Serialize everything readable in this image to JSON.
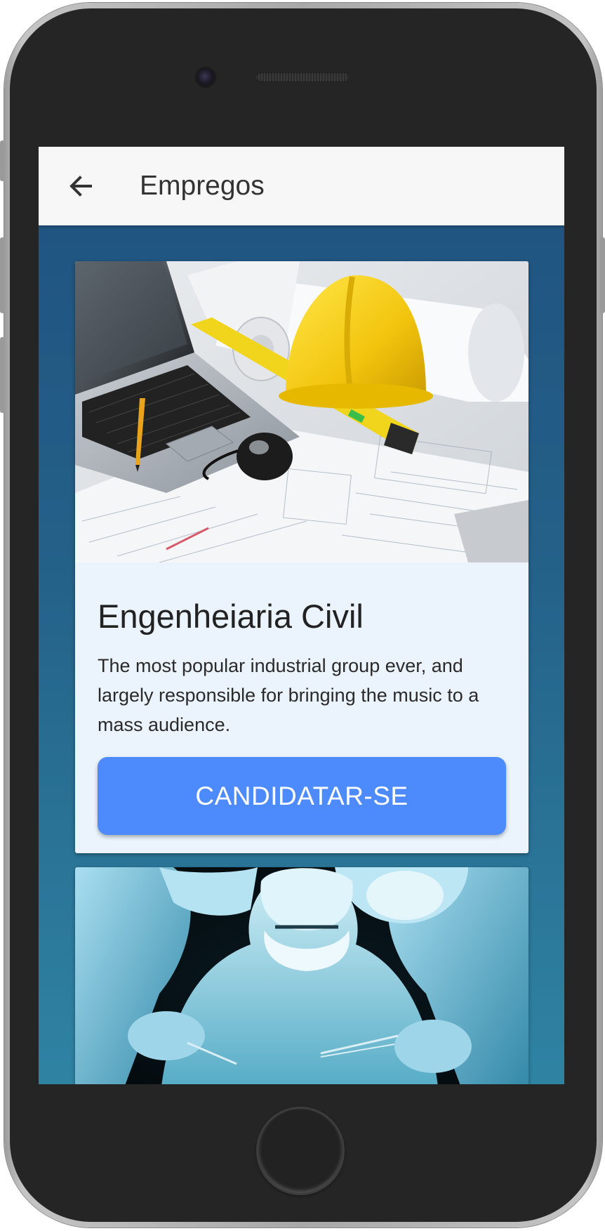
{
  "appbar": {
    "title": "Empregos",
    "back_icon": "arrow-left-icon"
  },
  "jobs": [
    {
      "image": "construction-desk-photo",
      "title": "Engenheiaria Civil",
      "description": "The most popular industrial group ever, and largely responsible for bringing the music to a mass audience.",
      "button_label": "CANDIDATAR-SE"
    },
    {
      "image": "surgeons-operating-photo"
    }
  ],
  "colors": {
    "appbar_bg": "#f7f7f7",
    "screen_bg_top": "#1f527f",
    "screen_bg_bottom": "#2f83a3",
    "card_bg": "#ebf4fd",
    "button_bg": "#4d8bfd",
    "button_text": "#ffffff"
  }
}
